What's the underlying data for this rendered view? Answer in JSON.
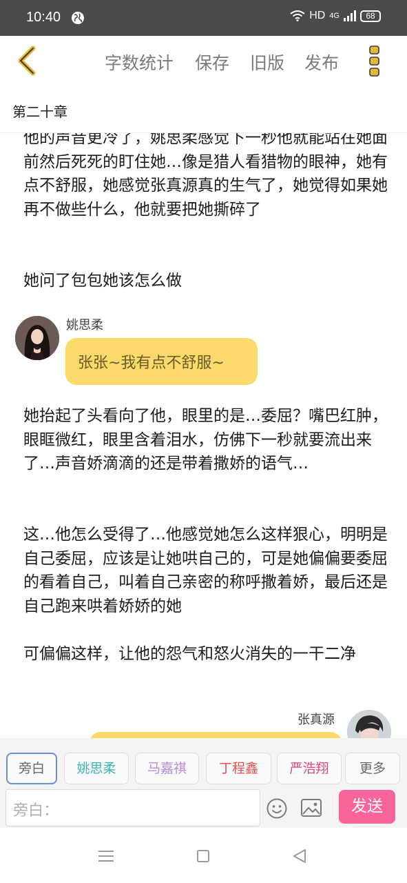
{
  "status_bar": {
    "time": "10:40",
    "network": "HD",
    "cellular": "4G",
    "battery": "68"
  },
  "toolbar": {
    "word_count_label": "字数统计",
    "save_label": "保存",
    "old_version_label": "旧版",
    "publish_label": "发布"
  },
  "chapter": {
    "title": "第二十章"
  },
  "story": {
    "para1": "他的声音更冷了，姚思柔感觉下一秒他就能站在她面前然后死死的盯住她…像是猎人看猎物的眼神，她有点不舒服，她感觉张真源真的生气了，她觉得如果她再不做些什么，他就要把她撕碎了",
    "para2": "她问了包包她该怎么做",
    "dialogue_left": {
      "speaker": "姚思柔",
      "text": "张张~我有点不舒服~"
    },
    "para3": "她抬起了头看向了他，眼里的是…委屈？嘴巴红肿，眼眶微红，眼里含着泪水，仿佛下一秒就要流出来了…声音娇滴滴的还是带着撒娇的语气…",
    "para4": "这…他怎么受得了…他感觉她怎么这样狠心，明明是自己委屈，应该是让她哄自己的，可是她偏偏要委屈的看着自己，叫着自己亲密的称呼撒着娇，最后还是自己跑来哄着娇娇的她",
    "para5": "可偏偏这样，让他的怨气和怒火消失的一干二净",
    "dialogue_right": {
      "speaker": "张真源"
    }
  },
  "roles": [
    {
      "label": "旁白",
      "color": "#666666"
    },
    {
      "label": "姚思柔",
      "color": "#3bb5b0"
    },
    {
      "label": "马嘉祺",
      "color": "#b58ad6"
    },
    {
      "label": "丁程鑫",
      "color": "#e0524f"
    },
    {
      "label": "严浩翔",
      "color": "#e0457f"
    },
    {
      "label": "更多",
      "color": "#666666"
    }
  ],
  "composer": {
    "placeholder": "旁白：",
    "send_label": "发送"
  },
  "colors": {
    "accent": "#f9649a",
    "bubble": "#fbd96a",
    "back_icon": "#e8b73a"
  }
}
